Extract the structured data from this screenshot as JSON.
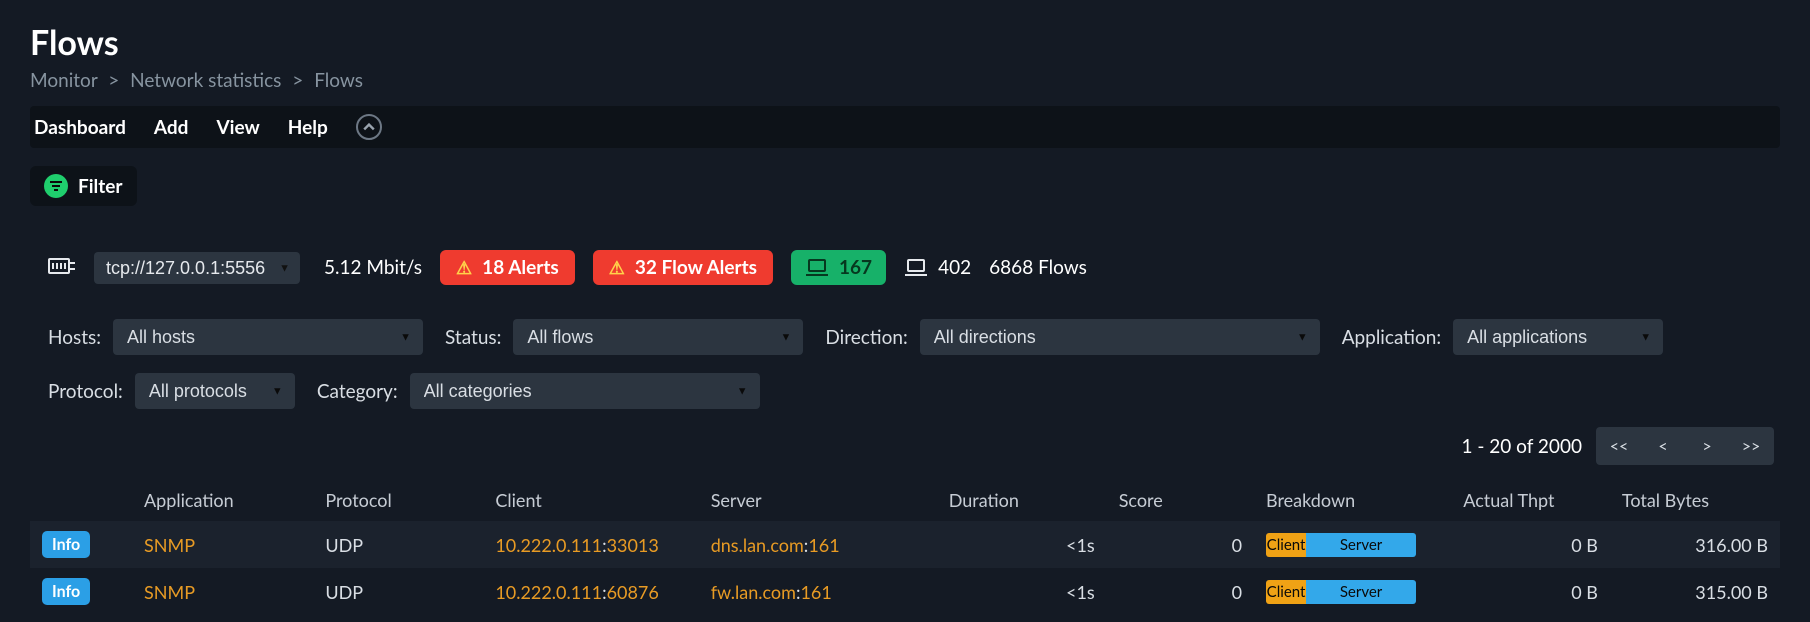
{
  "title": "Flows",
  "breadcrumbs": [
    "Monitor",
    "Network statistics",
    "Flows"
  ],
  "menu": {
    "items": [
      "Dashboard",
      "Add",
      "View",
      "Help"
    ]
  },
  "filter_button": "Filter",
  "status": {
    "interface_selected": "tcp://127.0.0.1:5556",
    "rate": "5.12 Mbit/s",
    "alerts": "18 Alerts",
    "flow_alerts": "32 Flow Alerts",
    "hosts_green": "167",
    "hosts_plain": "402",
    "flow_count": "6868 Flows"
  },
  "filters": {
    "hosts_label": "Hosts:",
    "hosts_value": "All hosts",
    "status_label": "Status:",
    "status_value": "All flows",
    "direction_label": "Direction:",
    "direction_value": "All directions",
    "application_label": "Application:",
    "application_value": "All applications",
    "protocol_label": "Protocol:",
    "protocol_value": "All protocols",
    "category_label": "Category:",
    "category_value": "All categories"
  },
  "pager": {
    "text": "1 - 20 of 2000",
    "first": "<<",
    "prev": "<",
    "next": ">",
    "last": ">>"
  },
  "table": {
    "headers": {
      "info": "",
      "application": "Application",
      "protocol": "Protocol",
      "client": "Client",
      "server": "Server",
      "duration": "Duration",
      "score": "Score",
      "breakdown": "Breakdown",
      "actual_thpt": "Actual Thpt",
      "total_bytes": "Total Bytes"
    },
    "info_label": "Info",
    "breakdown_client": "Client",
    "breakdown_server": "Server",
    "rows": [
      {
        "application": "SNMP",
        "protocol": "UDP",
        "client_ip": "10.222.0.111",
        "client_port": "33013",
        "server_host": "dns.lan.com",
        "server_port": "161",
        "duration": "<1s",
        "score": "0",
        "actual_thpt": "0 B",
        "total_bytes": "316.00 B"
      },
      {
        "application": "SNMP",
        "protocol": "UDP",
        "client_ip": "10.222.0.111",
        "client_port": "60876",
        "server_host": "fw.lan.com",
        "server_port": "161",
        "duration": "<1s",
        "score": "0",
        "actual_thpt": "0 B",
        "total_bytes": "315.00 B"
      }
    ]
  }
}
